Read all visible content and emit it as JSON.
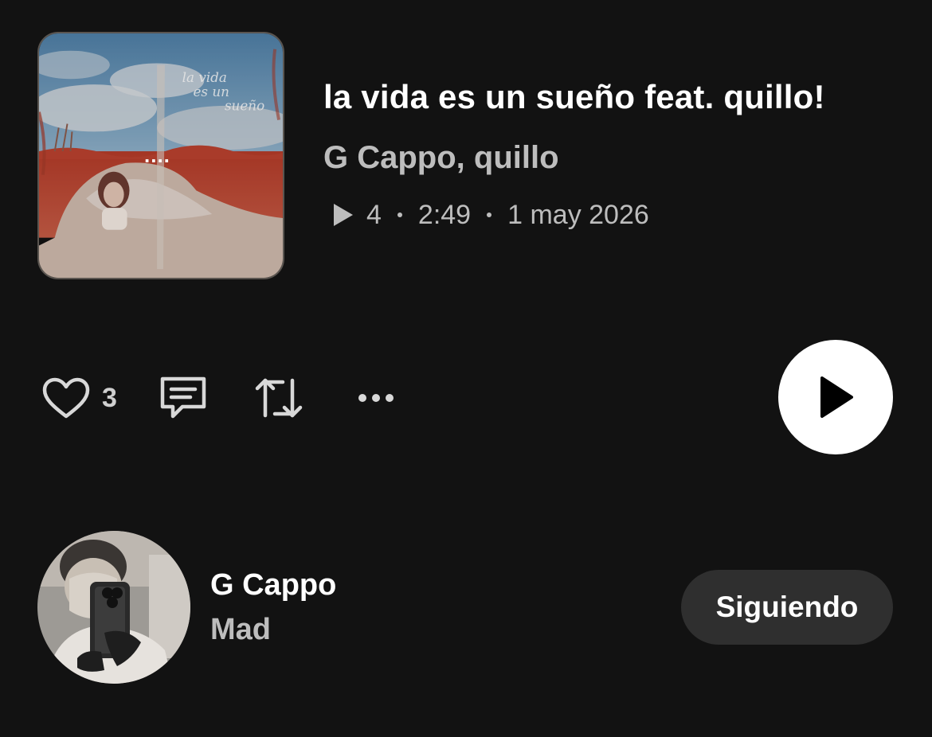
{
  "track": {
    "title": "la vida es un sueño feat. quillo!",
    "artists": "G Cappo, quillo",
    "plays": "4",
    "duration": "2:49",
    "date": "1 may 2026",
    "cover_art": {
      "overlay_text": "la vida es un sueño",
      "dots": "....",
      "colors": {
        "sky": "#5f88a8",
        "cloud": "#c9cdd2",
        "red": "#b8402e",
        "sheet": "#c9b3a6"
      }
    }
  },
  "actions": {
    "like_icon": "heart-outline-icon",
    "like_count": "3",
    "comment_icon": "comment-icon",
    "repost_icon": "repost-icon",
    "more_icon": "more-horizontal-icon",
    "play_icon": "play-icon"
  },
  "artist": {
    "name": "G Cappo",
    "location": "Mad",
    "follow_label": "Siguiendo"
  },
  "colors": {
    "background": "#121212",
    "primary_text": "#ffffff",
    "secondary_text": "#bdbdbd",
    "button_bg": "#2f2f2f",
    "play_button_bg": "#ffffff"
  }
}
